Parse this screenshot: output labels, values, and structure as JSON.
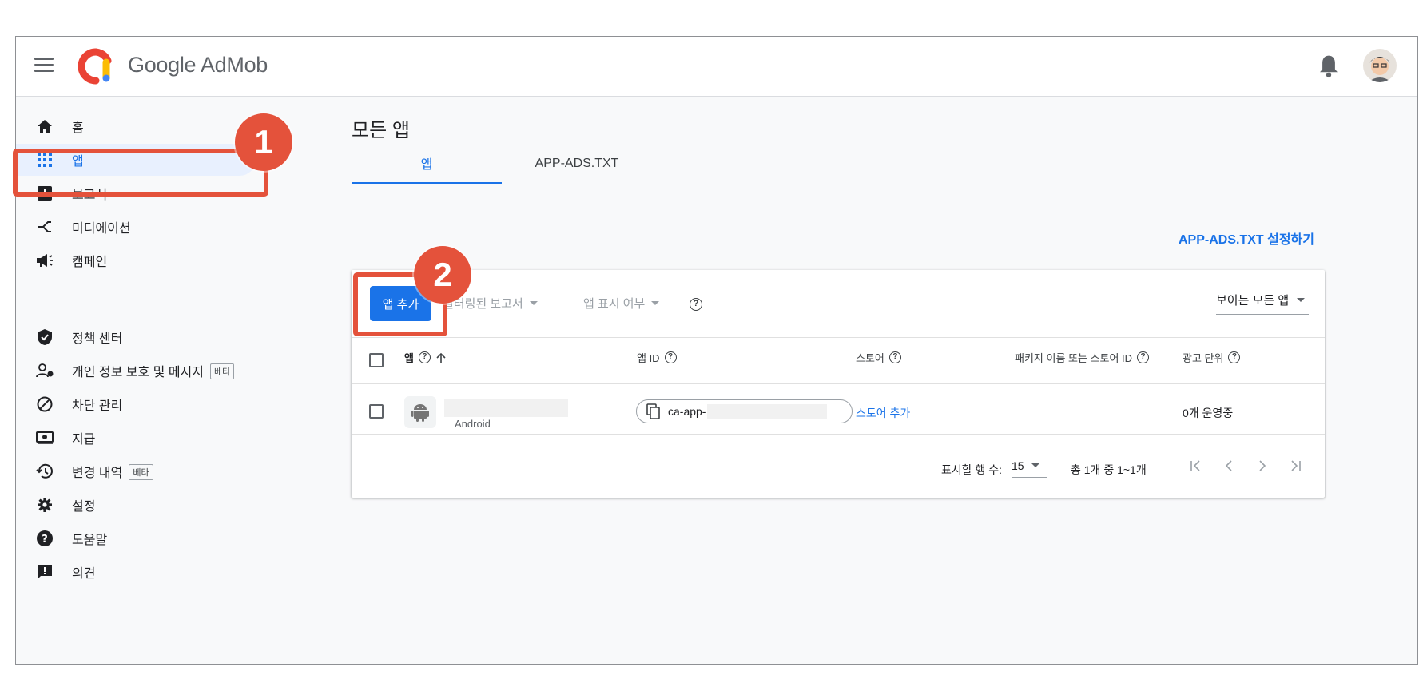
{
  "header": {
    "brand": "Google AdMob",
    "icons": {
      "menu": "menu-icon",
      "bell": "bell-icon",
      "avatar": "avatar"
    }
  },
  "sidebar": {
    "items": [
      {
        "label": "홈",
        "icon": "home-icon"
      },
      {
        "label": "앱",
        "icon": "apps-grid-icon",
        "active": true
      },
      {
        "label": "보고서",
        "icon": "bar-chart-icon"
      },
      {
        "label": "미디에이션",
        "icon": "mediation-icon"
      },
      {
        "label": "캠페인",
        "icon": "megaphone-icon"
      },
      {
        "label": "정책 센터",
        "icon": "shield-check-icon"
      },
      {
        "label": "개인 정보 보호 및 메시지",
        "icon": "privacy-person-icon",
        "badge": "베타"
      },
      {
        "label": "차단 관리",
        "icon": "block-icon"
      },
      {
        "label": "지급",
        "icon": "payment-icon"
      },
      {
        "label": "변경 내역",
        "icon": "history-icon",
        "badge": "베타"
      },
      {
        "label": "설정",
        "icon": "gear-icon"
      },
      {
        "label": "도움말",
        "icon": "help-icon"
      },
      {
        "label": "의견",
        "icon": "feedback-icon"
      }
    ]
  },
  "main": {
    "title": "모든 앱",
    "tabs": [
      {
        "label": "앱",
        "active": true
      },
      {
        "label": "APP-ADS.TXT",
        "active": false
      }
    ],
    "setup_link": "APP-ADS.TXT 설정하기"
  },
  "toolbar": {
    "add_app": "앱 추가",
    "filtered_reports": "필터링된 보고서",
    "app_visibility": "앱 표시 여부",
    "visible_select": "보이는 모든 앱"
  },
  "table": {
    "columns": {
      "app": "앱",
      "app_id": "앱 ID",
      "store": "스토어",
      "package": "패키지 이름 또는 스토어 ID",
      "ad_units": "광고 단위"
    },
    "rows": [
      {
        "platform": "Android",
        "app_id_prefix": "ca-app-",
        "store": "스토어 추가",
        "package": "–",
        "ad_units": "0개 운영중"
      }
    ]
  },
  "pagination": {
    "rows_label": "표시할 행 수:",
    "rows_value": "15",
    "range": "총 1개 중 1~1개"
  },
  "annotations": {
    "step1": "1",
    "step2": "2"
  },
  "colors": {
    "accent": "#1a73e8",
    "annotation": "#e4523b",
    "active_bg": "#e8f0fe"
  }
}
